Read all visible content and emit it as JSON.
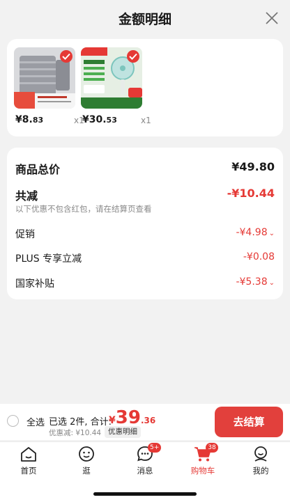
{
  "header": {
    "title": "金额明细"
  },
  "products": [
    {
      "price_int": "¥8.",
      "price_dec": "83",
      "qty": "x1"
    },
    {
      "price_int": "¥30.",
      "price_dec": "53",
      "qty": "x1"
    }
  ],
  "summary": {
    "total_label": "商品总价",
    "total_value": "¥49.80",
    "discount_label": "共减",
    "discount_value": "-¥10.44",
    "note": "以下优惠不包含红包，请在结算页查看",
    "items": [
      {
        "label": "促销",
        "value": "-¥4.98"
      },
      {
        "label": "PLUS 专享立减",
        "value": "-¥0.08"
      },
      {
        "label": "国家补贴",
        "value": "-¥5.38"
      }
    ]
  },
  "bottom": {
    "select_all": "全选",
    "selected_info": "已选 2件, 合计:",
    "total_yen": "¥",
    "total_int": "39",
    "total_dec": ".36",
    "savings": "优惠减: ¥10.44",
    "detail_button": "优惠明细",
    "checkout": "去结算"
  },
  "tabs": [
    {
      "label": "首页",
      "badge": ""
    },
    {
      "label": "逛",
      "badge": ""
    },
    {
      "label": "消息",
      "badge": "5+"
    },
    {
      "label": "购物车",
      "badge": "38"
    },
    {
      "label": "我的",
      "badge": ""
    }
  ],
  "colors": {
    "accent": "#e53935",
    "background": "#f2f2f2"
  }
}
